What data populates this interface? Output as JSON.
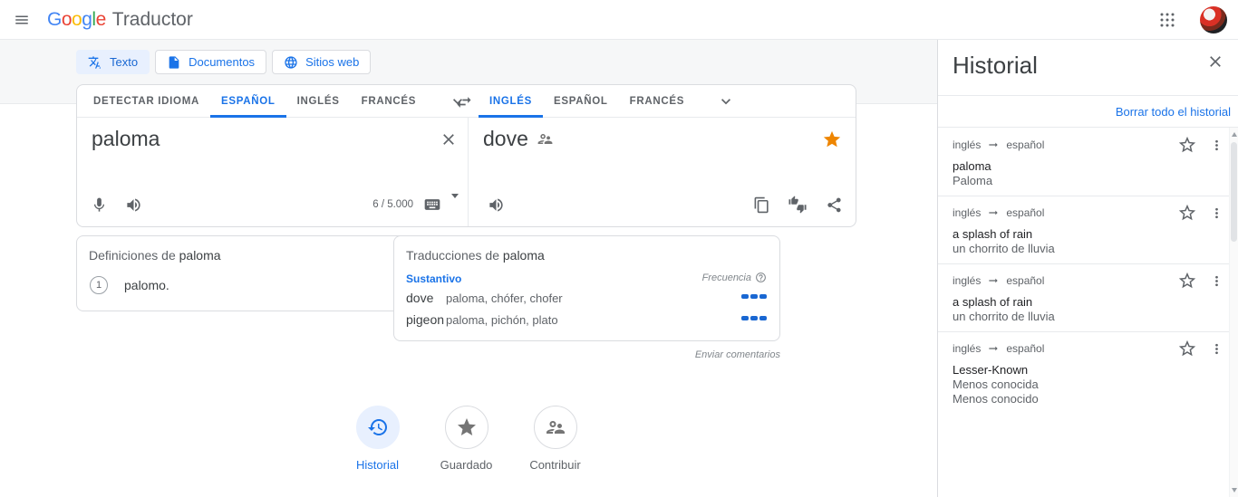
{
  "topbar": {
    "logo_letters": [
      {
        "ch": "G",
        "color": "#4285F4"
      },
      {
        "ch": "o",
        "color": "#EA4335"
      },
      {
        "ch": "o",
        "color": "#FBBC05"
      },
      {
        "ch": "g",
        "color": "#4285F4"
      },
      {
        "ch": "l",
        "color": "#34A853"
      },
      {
        "ch": "e",
        "color": "#EA4335"
      }
    ],
    "product_name": "Traductor"
  },
  "mode_buttons": [
    {
      "label": "Texto",
      "icon": "translate-icon",
      "active": true
    },
    {
      "label": "Documentos",
      "icon": "document-icon",
      "active": false
    },
    {
      "label": "Sitios web",
      "icon": "globe-icon",
      "active": false
    }
  ],
  "source_tabs": [
    {
      "label": "DETECTAR IDIOMA",
      "active": false
    },
    {
      "label": "ESPAÑOL",
      "active": true
    },
    {
      "label": "INGLÉS",
      "active": false
    },
    {
      "label": "FRANCÉS",
      "active": false
    }
  ],
  "target_tabs": [
    {
      "label": "INGLÉS",
      "active": true
    },
    {
      "label": "ESPAÑOL",
      "active": false
    },
    {
      "label": "FRANCÉS",
      "active": false
    }
  ],
  "source_panel": {
    "text": "paloma",
    "char_counter": "6 / 5.000"
  },
  "target_panel": {
    "text": "dove"
  },
  "definitions_card": {
    "title_prefix": "Definiciones de",
    "title_word": "paloma",
    "entries": [
      {
        "number": "1",
        "text": "palomo."
      }
    ]
  },
  "translations_card": {
    "title_prefix": "Traducciones de",
    "title_word": "paloma",
    "part_of_speech": "Sustantivo",
    "frequency_label": "Frecuencia",
    "rows": [
      {
        "term": "dove",
        "reverse_translations": "paloma, chófer, chofer",
        "frequency_level": 3,
        "frequency_max": 3
      },
      {
        "term": "pigeon",
        "reverse_translations": "paloma, pichón, plato",
        "frequency_level": 3,
        "frequency_max": 3
      }
    ]
  },
  "feedback": {
    "label": "Enviar comentarios"
  },
  "bottom_nav": [
    {
      "label": "Historial",
      "icon": "history-icon",
      "active": true
    },
    {
      "label": "Guardado",
      "icon": "star-icon",
      "active": false
    },
    {
      "label": "Contribuir",
      "icon": "people-icon",
      "active": false
    }
  ],
  "history_panel": {
    "title": "Historial",
    "clear_all_label": "Borrar todo el historial",
    "items": [
      {
        "lang_from": "inglés",
        "lang_to": "español",
        "source": "paloma",
        "targets": [
          "Paloma"
        ]
      },
      {
        "lang_from": "inglés",
        "lang_to": "español",
        "source": "a splash of rain",
        "targets": [
          "un chorrito de lluvia"
        ]
      },
      {
        "lang_from": "inglés",
        "lang_to": "español",
        "source": "a splash of rain",
        "targets": [
          "un chorrito de lluvia"
        ]
      },
      {
        "lang_from": "inglés",
        "lang_to": "español",
        "source": "Lesser-Known",
        "targets": [
          "Menos conocida",
          "Menos conocido"
        ]
      }
    ]
  },
  "icons": {
    "hamburger-icon": "menu ≡",
    "apps-grid-icon": "3×3 dots",
    "translate-icon": "文A",
    "document-icon": "file",
    "globe-icon": "language globe",
    "swap-languages-icon": "⇄",
    "chevron-down-icon": "∨",
    "close-icon": "✕",
    "mic-icon": "🎤",
    "speaker-icon": "🔊",
    "keyboard-icon": "⌨",
    "copy-icon": "⧉",
    "rate-translation-icon": "👍👎",
    "share-icon": "share",
    "star-filled-icon": "★",
    "star-outline-icon": "☆",
    "people-icon": "👥",
    "history-icon": "↺clock",
    "help-icon": "?",
    "more-vert-icon": "⋮",
    "arrow-right-icon": "→"
  },
  "colors": {
    "accent_blue": "#1a73e8",
    "blue_dark": "#1967d2",
    "text_dark": "#202124",
    "text_gray": "#5f6368",
    "border": "#dadce0",
    "divider": "#e8eaed",
    "chip_active_bg": "#e8f0fe",
    "star_active": "#ee8500",
    "strip_bg": "#f6f7f8"
  }
}
